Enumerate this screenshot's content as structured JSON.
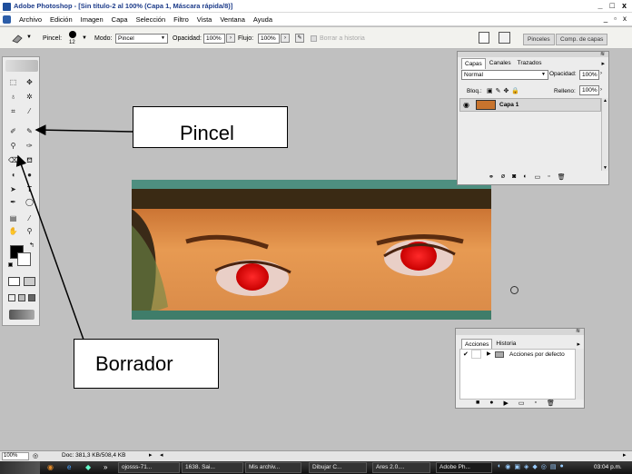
{
  "window": {
    "app_name": "Adobe Photoshop",
    "document": "[Sin título-2 al 100% (Capa 1, Máscara rápida/8)]",
    "minimize": "_",
    "maximize": "□",
    "close": "x"
  },
  "menu": [
    "Archivo",
    "Edición",
    "Imagen",
    "Capa",
    "Selección",
    "Filtro",
    "Vista",
    "Ventana",
    "Ayuda"
  ],
  "doc_controls": [
    "_",
    "▫",
    "x"
  ],
  "options": {
    "brush_label": "Pincel:",
    "brush_size": "12",
    "mode_label": "Modo:",
    "mode_value": "Pincel",
    "opacity_label": "Opacidad:",
    "opacity_value": "100%",
    "flow_label": "Flujo:",
    "flow_value": "100%",
    "erase_history": "Borrar a historia",
    "dock_tabs": [
      "Pinceles",
      "Comp. de capas"
    ]
  },
  "callouts": {
    "pincel": "Pincel",
    "borrador": "Borrador"
  },
  "layers_panel": {
    "tabs": [
      "Capas",
      "Canales",
      "Trazados"
    ],
    "blend_mode": "Normal",
    "opacity_label": "Opacidad:",
    "opacity_value": "100%",
    "lock_label": "Bloq.:",
    "fill_label": "Relleno:",
    "fill_value": "100%",
    "layer_name": "Capa 1"
  },
  "actions_panel": {
    "tabs": [
      "Acciones",
      "Historia"
    ],
    "item": "Acciones por defecto"
  },
  "status": {
    "zoom": "100%",
    "doc": "Doc: 381,3 KB/508,4 KB"
  },
  "taskbar": {
    "tasks": [
      "ojosss-71...",
      "1638. Sai...",
      "Mis archiv...",
      "Dibujar C...",
      "Ares 2.0....",
      "Adobe Ph..."
    ],
    "clock": "03:04 p.m."
  }
}
